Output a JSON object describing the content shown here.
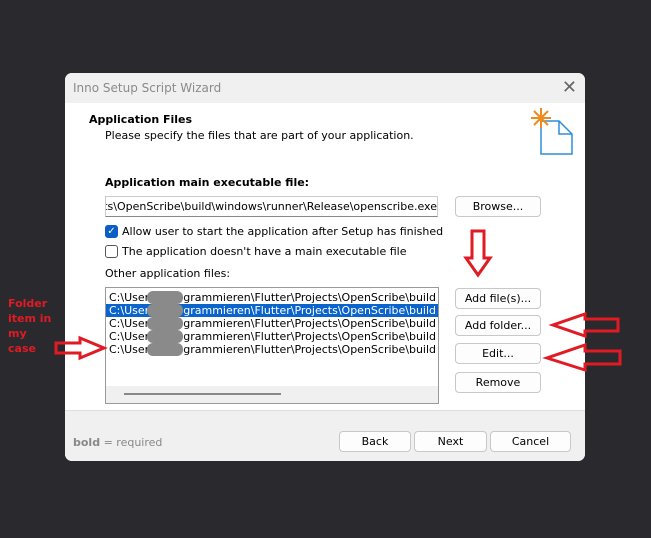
{
  "window": {
    "title": "Inno Setup Script Wizard",
    "close_icon": "close-icon"
  },
  "header": {
    "title": "Application Files",
    "subtitle": "Please specify the files that are part of your application.",
    "icon": "new-file-sparkle-icon"
  },
  "main_exe": {
    "label": "Application main executable file:",
    "value": "ects\\OpenScribe\\build\\windows\\runner\\Release\\openscribe.exe",
    "browse_label": "Browse..."
  },
  "options": [
    {
      "label": "Allow user to start the application after Setup has finished",
      "checked": true
    },
    {
      "label": "The application doesn't have a main executable file",
      "checked": false
    }
  ],
  "other_files": {
    "label": "Other application files:",
    "items": [
      {
        "text": "C:\\Users\\     \\Programmieren\\Flutter\\Projects\\OpenScribe\\build",
        "selected": false
      },
      {
        "text": "C:\\Users\\     \\Programmieren\\Flutter\\Projects\\OpenScribe\\build",
        "selected": true
      },
      {
        "text": "C:\\Users\\     \\Programmieren\\Flutter\\Projects\\OpenScribe\\build",
        "selected": false
      },
      {
        "text": "C:\\Users\\     \\Programmieren\\Flutter\\Projects\\OpenScribe\\build",
        "selected": false
      },
      {
        "text": "C:\\Users\\     \\Programmieren\\Flutter\\Projects\\OpenScribe\\build",
        "selected": false
      }
    ]
  },
  "side_buttons": {
    "add_files": "Add file(s)...",
    "add_folder": "Add folder...",
    "edit": "Edit...",
    "remove": "Remove"
  },
  "footer": {
    "legend_bold": "bold",
    "legend_rest": " = required",
    "back": "Back",
    "next": "Next",
    "cancel": "Cancel"
  },
  "annotation": {
    "text": "Folder item in my case",
    "color": "#e01b24"
  },
  "colors": {
    "accent": "#0a64cc",
    "background": "#2a292d"
  }
}
